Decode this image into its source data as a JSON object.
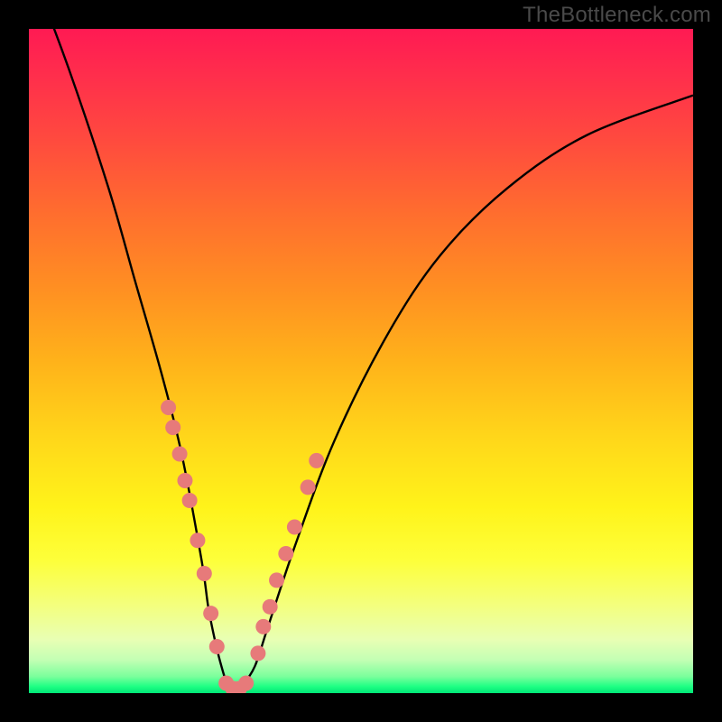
{
  "watermark": "TheBottleneck.com",
  "colors": {
    "curve": "#000000",
    "dot_fill": "#e77a7a",
    "dot_stroke": "#c85a5a",
    "background": "#000000"
  },
  "chart_data": {
    "type": "line",
    "title": "",
    "xlabel": "",
    "ylabel": "",
    "xlim": [
      0,
      100
    ],
    "ylim": [
      0,
      100
    ],
    "series": [
      {
        "name": "bottleneck-curve",
        "x": [
          0,
          6,
          12,
          16,
          20,
          23,
          26,
          27,
          28,
          29,
          30,
          31,
          32,
          34,
          36,
          40,
          46,
          54,
          62,
          72,
          84,
          100
        ],
        "y": [
          110,
          94,
          76,
          62,
          48,
          36,
          20,
          13,
          8,
          4,
          1,
          0.5,
          1,
          4,
          10,
          22,
          38,
          54,
          66,
          76,
          84,
          90
        ]
      }
    ],
    "dots": {
      "left_branch": [
        {
          "x": 21.0,
          "y": 43
        },
        {
          "x": 21.7,
          "y": 40
        },
        {
          "x": 22.7,
          "y": 36
        },
        {
          "x": 23.5,
          "y": 32
        },
        {
          "x": 24.2,
          "y": 29
        },
        {
          "x": 25.4,
          "y": 23
        },
        {
          "x": 26.4,
          "y": 18
        },
        {
          "x": 27.4,
          "y": 12
        },
        {
          "x": 28.3,
          "y": 7
        }
      ],
      "bottom": [
        {
          "x": 29.7,
          "y": 1.5
        },
        {
          "x": 30.7,
          "y": 0.7
        },
        {
          "x": 31.7,
          "y": 0.7
        },
        {
          "x": 32.7,
          "y": 1.5
        }
      ],
      "right_branch": [
        {
          "x": 34.5,
          "y": 6
        },
        {
          "x": 35.3,
          "y": 10
        },
        {
          "x": 36.3,
          "y": 13
        },
        {
          "x": 37.3,
          "y": 17
        },
        {
          "x": 38.7,
          "y": 21
        },
        {
          "x": 40.0,
          "y": 25
        },
        {
          "x": 42.0,
          "y": 31
        },
        {
          "x": 43.3,
          "y": 35
        }
      ]
    }
  }
}
